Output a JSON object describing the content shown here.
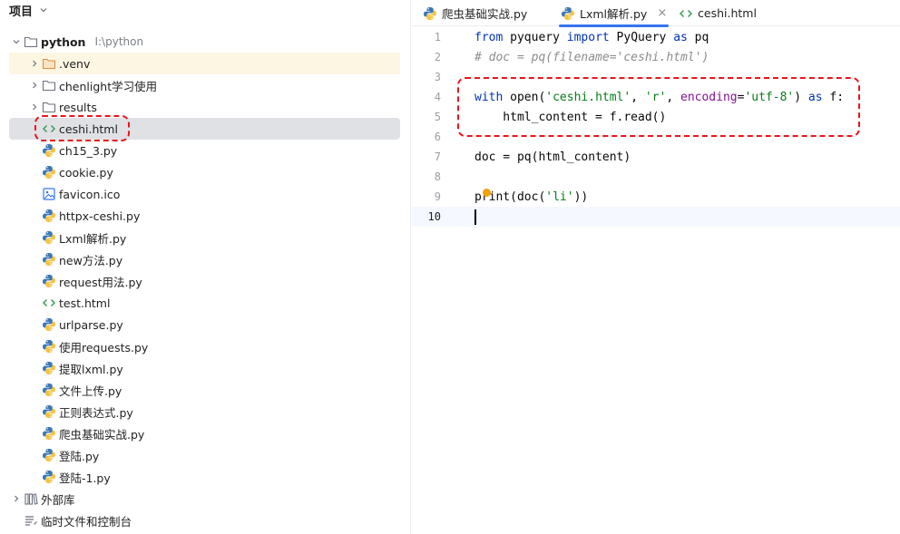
{
  "project": {
    "title": "项目",
    "root": {
      "name": "python",
      "path": "I:\\python"
    },
    "items": [
      {
        "label": ".venv",
        "type": "folder",
        "expandable": true,
        "highlighted": true
      },
      {
        "label": "chenlight学习使用",
        "type": "folder",
        "expandable": true
      },
      {
        "label": "results",
        "type": "folder",
        "expandable": true
      },
      {
        "label": "ceshi.html",
        "type": "html",
        "selected": true
      },
      {
        "label": "ch15_3.py",
        "type": "python"
      },
      {
        "label": "cookie.py",
        "type": "python"
      },
      {
        "label": "favicon.ico",
        "type": "image"
      },
      {
        "label": "httpx-ceshi.py",
        "type": "python"
      },
      {
        "label": "Lxml解析.py",
        "type": "python"
      },
      {
        "label": "new方法.py",
        "type": "python"
      },
      {
        "label": "request用法.py",
        "type": "python"
      },
      {
        "label": "test.html",
        "type": "html"
      },
      {
        "label": "urlparse.py",
        "type": "python"
      },
      {
        "label": "使用requests.py",
        "type": "python"
      },
      {
        "label": "提取lxml.py",
        "type": "python"
      },
      {
        "label": "文件上传.py",
        "type": "python"
      },
      {
        "label": "正则表达式.py",
        "type": "python"
      },
      {
        "label": "爬虫基础实战.py",
        "type": "python"
      },
      {
        "label": "登陆.py",
        "type": "python"
      },
      {
        "label": "登陆-1.py",
        "type": "python"
      }
    ],
    "external_libraries": "外部库",
    "scratches": "临时文件和控制台"
  },
  "tabs": [
    {
      "label": "爬虫基础实战.py",
      "type": "python",
      "active": false
    },
    {
      "label": "Lxml解析.py",
      "type": "python",
      "active": true,
      "close": "×"
    },
    {
      "label": "ceshi.html",
      "type": "html",
      "active": false
    }
  ],
  "editor": {
    "line_numbers": [
      "1",
      "2",
      "3",
      "4",
      "5",
      "6",
      "7",
      "8",
      "9",
      "10"
    ],
    "current_line": 10,
    "tokens": {
      "l1_from": "from",
      "l1_mod": " pyquery ",
      "l1_import": "import",
      "l1_cls": " PyQuery ",
      "l1_as": "as",
      "l1_alias": " pq",
      "l2_comment": "# doc = pq(filename='ceshi.html')",
      "l4_with": "with",
      "l4_open": " open(",
      "l4_s1": "'ceshi.html'",
      "l4_c1": ", ",
      "l4_s2": "'r'",
      "l4_c2": ", ",
      "l4_kwarg": "encoding",
      "l4_eq": "=",
      "l4_s3": "'utf-8'",
      "l4_close": ") ",
      "l4_as": "as",
      "l4_f": " f:",
      "l5_code": "    html_content = f.read()",
      "l7_code": "doc = pq(html_content)",
      "l9_pre": "print(doc(",
      "l9_str": "'li'",
      "l9_post": "))"
    }
  },
  "colors": {
    "accent": "#3574f0",
    "annotation": "#e8151b",
    "keyword": "#0033b3",
    "string": "#067d17",
    "comment": "#8c8c8c",
    "python_blue": "#3d77b5",
    "python_yellow": "#f5c342"
  }
}
